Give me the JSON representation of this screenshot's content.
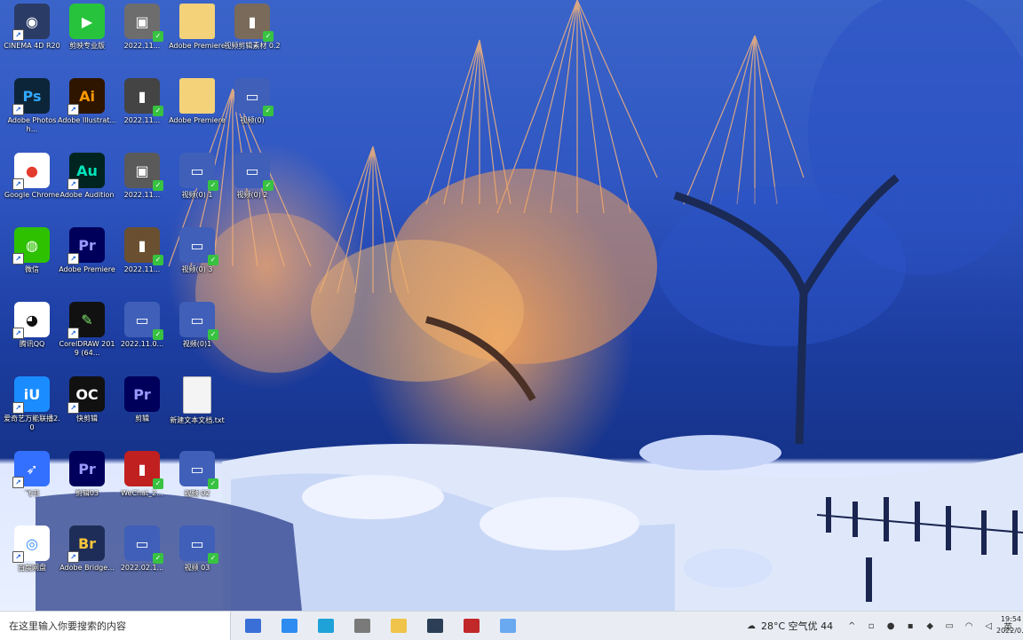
{
  "desktop_icons": [
    {
      "name": "cinema4d-shortcut",
      "label": "CINEMA 4D R20",
      "glyph": "◉",
      "bg": "#2a3b66",
      "fg": "#ffffff",
      "arrow": true
    },
    {
      "name": "video-app-shortcut",
      "label": "剪映专业版",
      "glyph": "▶",
      "bg": "#28c33c",
      "fg": "#ffffff",
      "arrow": false
    },
    {
      "name": "video-file-1",
      "label": "2022.11...",
      "glyph": "▣",
      "bg": "#6d6d6d",
      "fg": "#ffffff",
      "badge": true
    },
    {
      "name": "folder-1",
      "label": "Adobe Premiere",
      "glyph": "",
      "bg": "#f3d27a",
      "fg": "#ffffff"
    },
    {
      "name": "video-file-2",
      "label": "视频剪辑素材 0.2",
      "glyph": "▮",
      "bg": "#7a6a5a",
      "fg": "#ffffff",
      "badge": true
    },
    {
      "name": "photoshop-shortcut",
      "label": "Adobe Photosh...",
      "glyph": "Ps",
      "bg": "#0d2538",
      "fg": "#31a8ff",
      "arrow": true
    },
    {
      "name": "illustrator-shortcut",
      "label": "Adobe Illustrat...",
      "glyph": "Ai",
      "bg": "#2e1500",
      "fg": "#ff9a00",
      "arrow": true
    },
    {
      "name": "video-file-3",
      "label": "2022.11...",
      "glyph": "▮",
      "bg": "#444",
      "fg": "#ffffff",
      "badge": true
    },
    {
      "name": "folder-2",
      "label": "Adobe Premiere",
      "glyph": "",
      "bg": "#f3d27a",
      "fg": "#ffffff"
    },
    {
      "name": "media-file-1",
      "label": "视频(0)",
      "glyph": "▭",
      "bg": "#3f5fb8",
      "fg": "#ffffff",
      "badge": true
    },
    {
      "name": "chrome-shortcut",
      "label": "Google Chrome",
      "glyph": "●",
      "bg": "#ffffff",
      "fg": "#e33b2e",
      "arrow": true
    },
    {
      "name": "audition-shortcut",
      "label": "Adobe Audition",
      "glyph": "Au",
      "bg": "#00241f",
      "fg": "#00e4bb",
      "arrow": true
    },
    {
      "name": "video-file-4",
      "label": "2022.11...",
      "glyph": "▣",
      "bg": "#5a5a5a",
      "fg": "#ffffff",
      "badge": true
    },
    {
      "name": "media-file-2",
      "label": "视频(0) 1",
      "glyph": "▭",
      "bg": "#3f5fb8",
      "fg": "#ffffff",
      "badge": true
    },
    {
      "name": "media-file-3",
      "label": "视频(0) 2",
      "glyph": "▭",
      "bg": "#3f5fb8",
      "fg": "#ffffff",
      "badge": true
    },
    {
      "name": "wechat-shortcut",
      "label": "微信",
      "glyph": "◍",
      "bg": "#2dc100",
      "fg": "#ffffff",
      "arrow": true
    },
    {
      "name": "premiere-shortcut",
      "label": "Adobe Premiere",
      "glyph": "Pr",
      "bg": "#00005b",
      "fg": "#9999ff",
      "arrow": true
    },
    {
      "name": "video-file-5",
      "label": "2022.11...",
      "glyph": "▮",
      "bg": "#6a5030",
      "fg": "#ffffff",
      "badge": true
    },
    {
      "name": "media-file-4",
      "label": "视频(0) 3",
      "glyph": "▭",
      "bg": "#3f5fb8",
      "fg": "#ffffff",
      "badge": true
    },
    {
      "name": "qq-shortcut",
      "label": "腾讯QQ",
      "glyph": "◕",
      "bg": "#ffffff",
      "fg": "#111111",
      "arrow": true
    },
    {
      "name": "coreldraw-shortcut",
      "label": "CorelDRAW 2019 (64...",
      "glyph": "✎",
      "bg": "#111111",
      "fg": "#7ee36c",
      "arrow": true
    },
    {
      "name": "media-file-5",
      "label": "2022.11.0...",
      "glyph": "▭",
      "bg": "#3f5fb8",
      "fg": "#ffffff",
      "badge": true
    },
    {
      "name": "media-file-6",
      "label": "视频(0)1",
      "glyph": "▭",
      "bg": "#3f5fb8",
      "fg": "#ffffff",
      "badge": true
    },
    {
      "name": "iqiyi-shortcut",
      "label": "爱奇艺万能联播2.0",
      "glyph": "iU",
      "bg": "#1a8cff",
      "fg": "#ffffff",
      "arrow": true
    },
    {
      "name": "oc-shortcut",
      "label": "快剪辑",
      "glyph": "OC",
      "bg": "#111111",
      "fg": "#ffffff",
      "arrow": true
    },
    {
      "name": "premiere-project-1",
      "label": "剪辑",
      "glyph": "Pr",
      "bg": "#00005b",
      "fg": "#9999ff"
    },
    {
      "name": "document-file",
      "label": "新建文本文档.txt",
      "glyph": "",
      "bg": "#f4f4f4",
      "fg": "#333333"
    },
    {
      "name": "feishu-shortcut",
      "label": "飞书",
      "glyph": "➶",
      "bg": "#3370ff",
      "fg": "#ffffff",
      "arrow": true
    },
    {
      "name": "premiere-project-2",
      "label": "剪辑03",
      "glyph": "Pr",
      "bg": "#00005b",
      "fg": "#9999ff"
    },
    {
      "name": "wechat-video-file",
      "label": "WeChat_2...",
      "glyph": "▮",
      "bg": "#c02020",
      "fg": "#ffffff",
      "badge": true
    },
    {
      "name": "media-file-7",
      "label": "视频 02",
      "glyph": "▭",
      "bg": "#3f5fb8",
      "fg": "#ffffff",
      "badge": true
    },
    {
      "name": "baidu-netdisk-shortcut",
      "label": "百度网盘",
      "glyph": "◎",
      "bg": "#ffffff",
      "fg": "#2f8cff",
      "arrow": true
    },
    {
      "name": "bridge-shortcut",
      "label": "Adobe Bridge...",
      "glyph": "Br",
      "bg": "#1e2d58",
      "fg": "#f7c43b",
      "arrow": true
    },
    {
      "name": "media-file-8",
      "label": "2022.02.1...",
      "glyph": "▭",
      "bg": "#3f5fb8",
      "fg": "#ffffff",
      "badge": true
    },
    {
      "name": "media-file-9",
      "label": "视频 03",
      "glyph": "▭",
      "bg": "#3f5fb8",
      "fg": "#ffffff",
      "badge": true
    }
  ],
  "taskbar": {
    "search_placeholder": "在这里输入你要搜索的内容",
    "apps": [
      {
        "name": "task-view",
        "color": "#3a6fd8"
      },
      {
        "name": "file-explorer",
        "color": "#2e8cf0"
      },
      {
        "name": "edge",
        "color": "#1fa2d8"
      },
      {
        "name": "taskbar-app-4",
        "color": "#7a7a7a"
      },
      {
        "name": "folder-app",
        "color": "#f0c34a"
      },
      {
        "name": "terminal-app",
        "color": "#2b3e55"
      },
      {
        "name": "red-app",
        "color": "#c0282a"
      },
      {
        "name": "blue-app",
        "color": "#6aa8f0"
      }
    ],
    "weather": "28°C 空气优 44",
    "clock_time": "19:54",
    "clock_date": "2022/0..."
  }
}
